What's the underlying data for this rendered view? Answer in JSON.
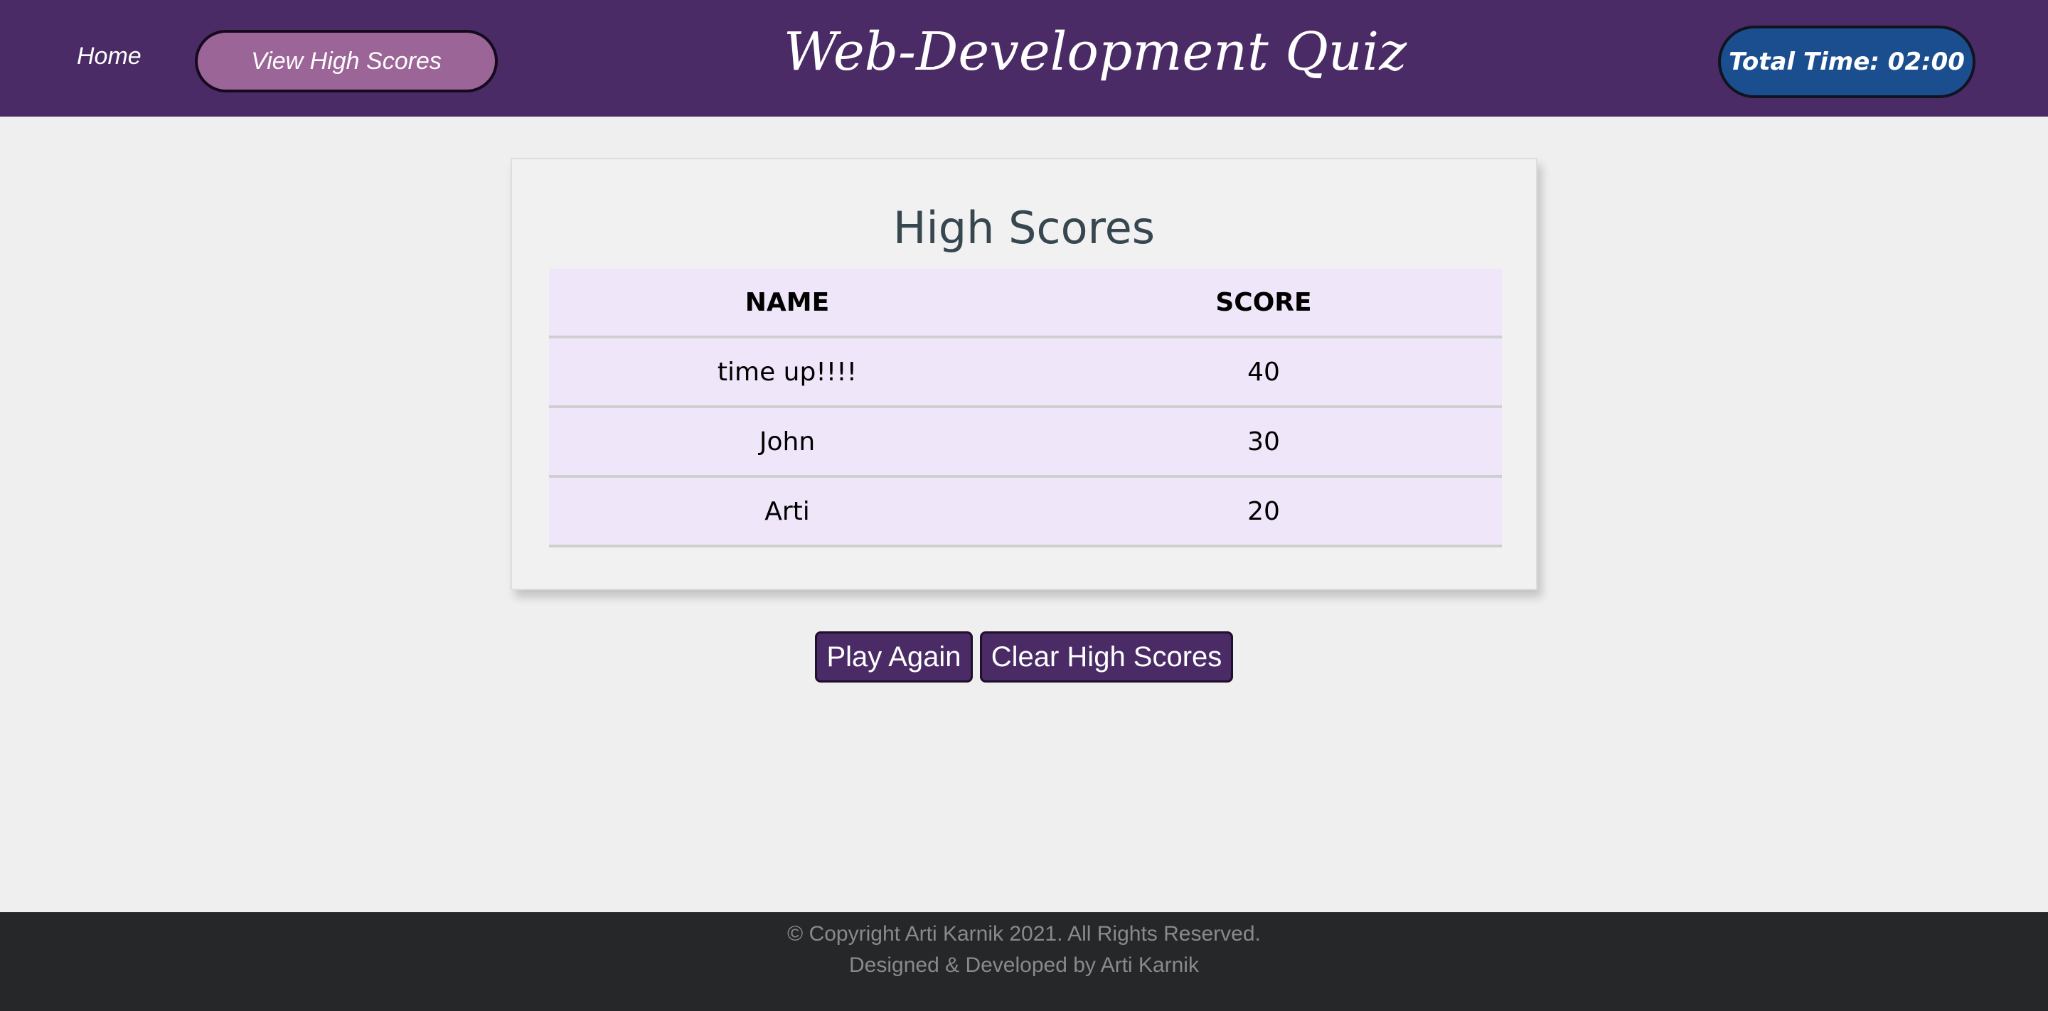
{
  "header": {
    "home_label": "Home",
    "high_scores_label": "View High Scores",
    "title": "Web-Development Quiz",
    "timer": "Total Time: 02:00"
  },
  "card": {
    "title": "High Scores",
    "columns": [
      "NAME",
      "SCORE"
    ],
    "rows": [
      {
        "name": "time up!!!!",
        "score": "40"
      },
      {
        "name": "John",
        "score": "30"
      },
      {
        "name": "Arti",
        "score": "20"
      }
    ]
  },
  "actions": {
    "play_again_label": "Play Again",
    "clear_label": "Clear High Scores"
  },
  "footer": {
    "copyright": "© Copyright Arti Karnik 2021. All Rights Reserved.",
    "credit": "Designed & Developed by Arti Karnik"
  },
  "colors": {
    "header_bg": "#4a2b66",
    "high_scores_button": "#9c6598",
    "timer_bg": "#1b4e8e",
    "table_bg": "#efe6f9",
    "footer_bg": "#262729"
  }
}
